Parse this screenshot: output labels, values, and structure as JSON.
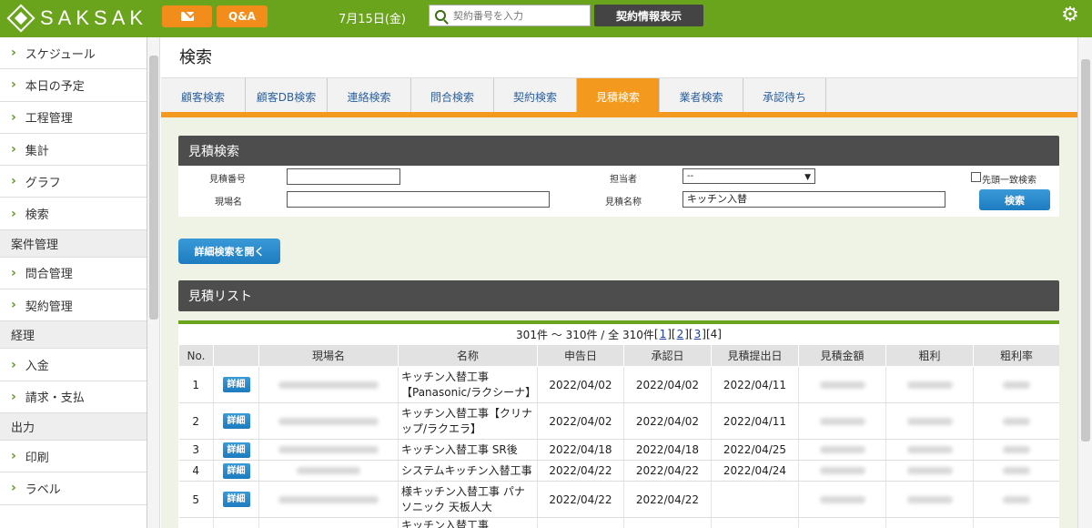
{
  "header": {
    "logo": "SAKSAK",
    "qa_label": "Q&A",
    "date": "7月15日(金)",
    "search_placeholder": "契約番号を入力",
    "contract_button": "契約情報表示"
  },
  "sidebar": {
    "items": [
      {
        "label": "スケジュール"
      },
      {
        "label": "本日の予定"
      },
      {
        "label": "工程管理"
      },
      {
        "label": "集計"
      },
      {
        "label": "グラフ"
      },
      {
        "label": "検索"
      }
    ],
    "section_case": "案件管理",
    "case_items": [
      {
        "label": "問合管理"
      },
      {
        "label": "契約管理"
      }
    ],
    "section_accounting": "経理",
    "accounting_items": [
      {
        "label": "入金"
      },
      {
        "label": "請求・支払"
      }
    ],
    "section_output": "出力",
    "output_items": [
      {
        "label": "印刷"
      },
      {
        "label": "ラベル"
      }
    ]
  },
  "page": {
    "title": "検索",
    "tabs": [
      "顧客検索",
      "顧客DB検索",
      "連絡検索",
      "問合検索",
      "契約検索",
      "見積検索",
      "業者検索",
      "承認待ち"
    ],
    "active_tab": "見積検索"
  },
  "search_form": {
    "title": "見積検索",
    "estimate_no_label": "見積番号",
    "estimate_no_value": "",
    "site_name_label": "現場名",
    "site_name_value": "",
    "staff_label": "担当者",
    "staff_value": "--",
    "estimate_name_label": "見積名称",
    "estimate_name_value": "キッチン入替",
    "prefix_match_label": "先頭一致検索",
    "search_button": "検索",
    "detail_open_button": "詳細検索を開く"
  },
  "list": {
    "title": "見積リスト",
    "pager_summary": "301件 ～ 310件 / 全 310件",
    "pages": [
      "1",
      "2",
      "3"
    ],
    "current_page": "4",
    "columns": [
      "No.",
      "",
      "現場名",
      "名称",
      "申告日",
      "承認日",
      "見積提出日",
      "見積金額",
      "粗利",
      "粗利率"
    ],
    "detail_label": "詳細",
    "rows": [
      {
        "no": "1",
        "name": "キッチン入替工事【Panasonic/ラクシーナ】",
        "declared": "2022/04/02",
        "approved": "2022/04/02",
        "submitted": "2022/04/11"
      },
      {
        "no": "2",
        "name": "キッチン入替工事【クリナップ/ラクエラ】",
        "declared": "2022/04/02",
        "approved": "2022/04/02",
        "submitted": "2022/04/11"
      },
      {
        "no": "3",
        "name": "キッチン入替工事 SR後",
        "declared": "2022/04/18",
        "approved": "2022/04/18",
        "submitted": "2022/04/25"
      },
      {
        "no": "4",
        "name": "システムキッチン入替工事",
        "declared": "2022/04/22",
        "approved": "2022/04/22",
        "submitted": "2022/04/24"
      },
      {
        "no": "5",
        "name": "様キッチン入替工事 パナソニック 天板人大",
        "declared": "2022/04/22",
        "approved": "2022/04/22",
        "submitted": ""
      }
    ],
    "partial_row_name": "キッチン入替工事【Panaso"
  }
}
